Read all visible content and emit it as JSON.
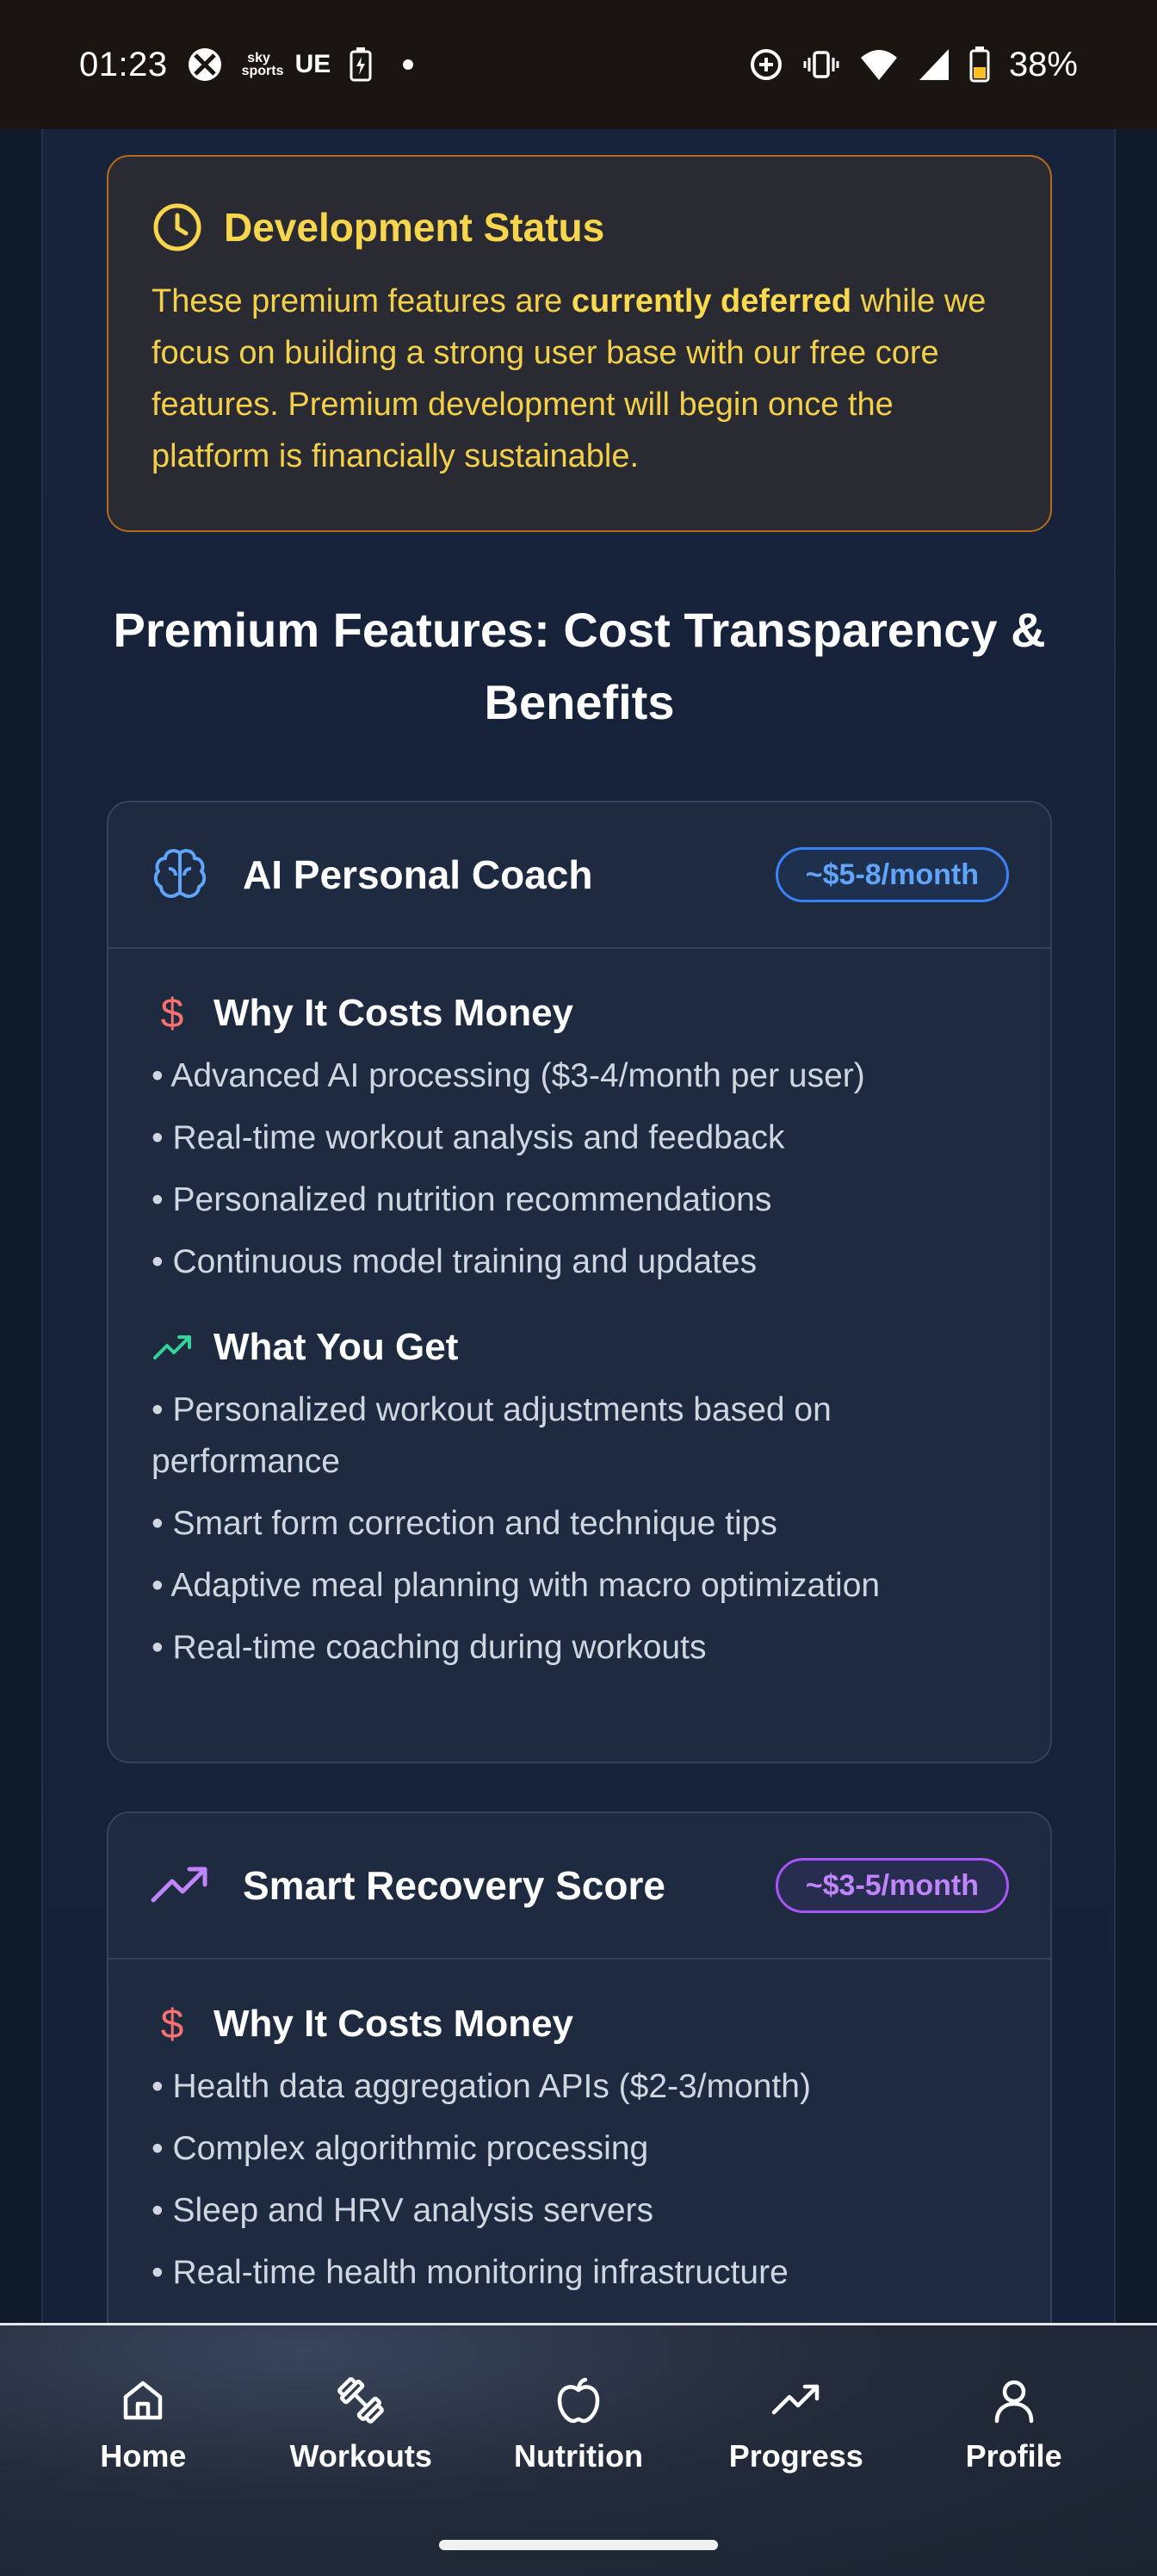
{
  "status_bar": {
    "time": "01:23",
    "carrier_logo": "sky sports",
    "ue_label": "UE",
    "battery_percent": "38%"
  },
  "dev_status": {
    "title": "Development Status",
    "text_before": "These premium features are ",
    "text_bold": "currently deferred",
    "text_after": " while we focus on building a strong user base with our free core features. Premium development will begin once the platform is financially sustainable."
  },
  "section": {
    "title": "Premium Features: Cost Transparency & Benefits"
  },
  "features": [
    {
      "name": "AI Personal Coach",
      "price": "~$5-8/month",
      "costs_title": "Why It Costs Money",
      "costs": [
        "• Advanced AI processing ($3-4/month per user)",
        "• Real-time workout analysis and feedback",
        "• Personalized nutrition recommendations",
        "• Continuous model training and updates"
      ],
      "benefits_title": "What You Get",
      "benefits": [
        "• Personalized workout adjustments based on performance",
        "• Smart form correction and technique tips",
        "• Adaptive meal planning with macro optimization",
        "• Real-time coaching during workouts"
      ]
    },
    {
      "name": "Smart Recovery Score",
      "price": "~$3-5/month",
      "costs_title": "Why It Costs Money",
      "costs": [
        "• Health data aggregation APIs ($2-3/month)",
        "• Complex algorithmic processing",
        "• Sleep and HRV analysis servers",
        "• Real-time health monitoring infrastructure"
      ]
    }
  ],
  "nav": {
    "items": [
      {
        "label": "Home",
        "icon": "home-icon"
      },
      {
        "label": "Workouts",
        "icon": "dumbbell-icon"
      },
      {
        "label": "Nutrition",
        "icon": "apple-icon"
      },
      {
        "label": "Progress",
        "icon": "trending-up-icon"
      },
      {
        "label": "Profile",
        "icon": "user-icon"
      }
    ]
  },
  "colors": {
    "warning_text": "#f3d04a",
    "warning_border": "#b56b1c",
    "blue_badge": "#3b82f6",
    "purple_badge": "#a855f7",
    "cost_icon": "#f87171",
    "benefit_icon": "#34d399"
  }
}
